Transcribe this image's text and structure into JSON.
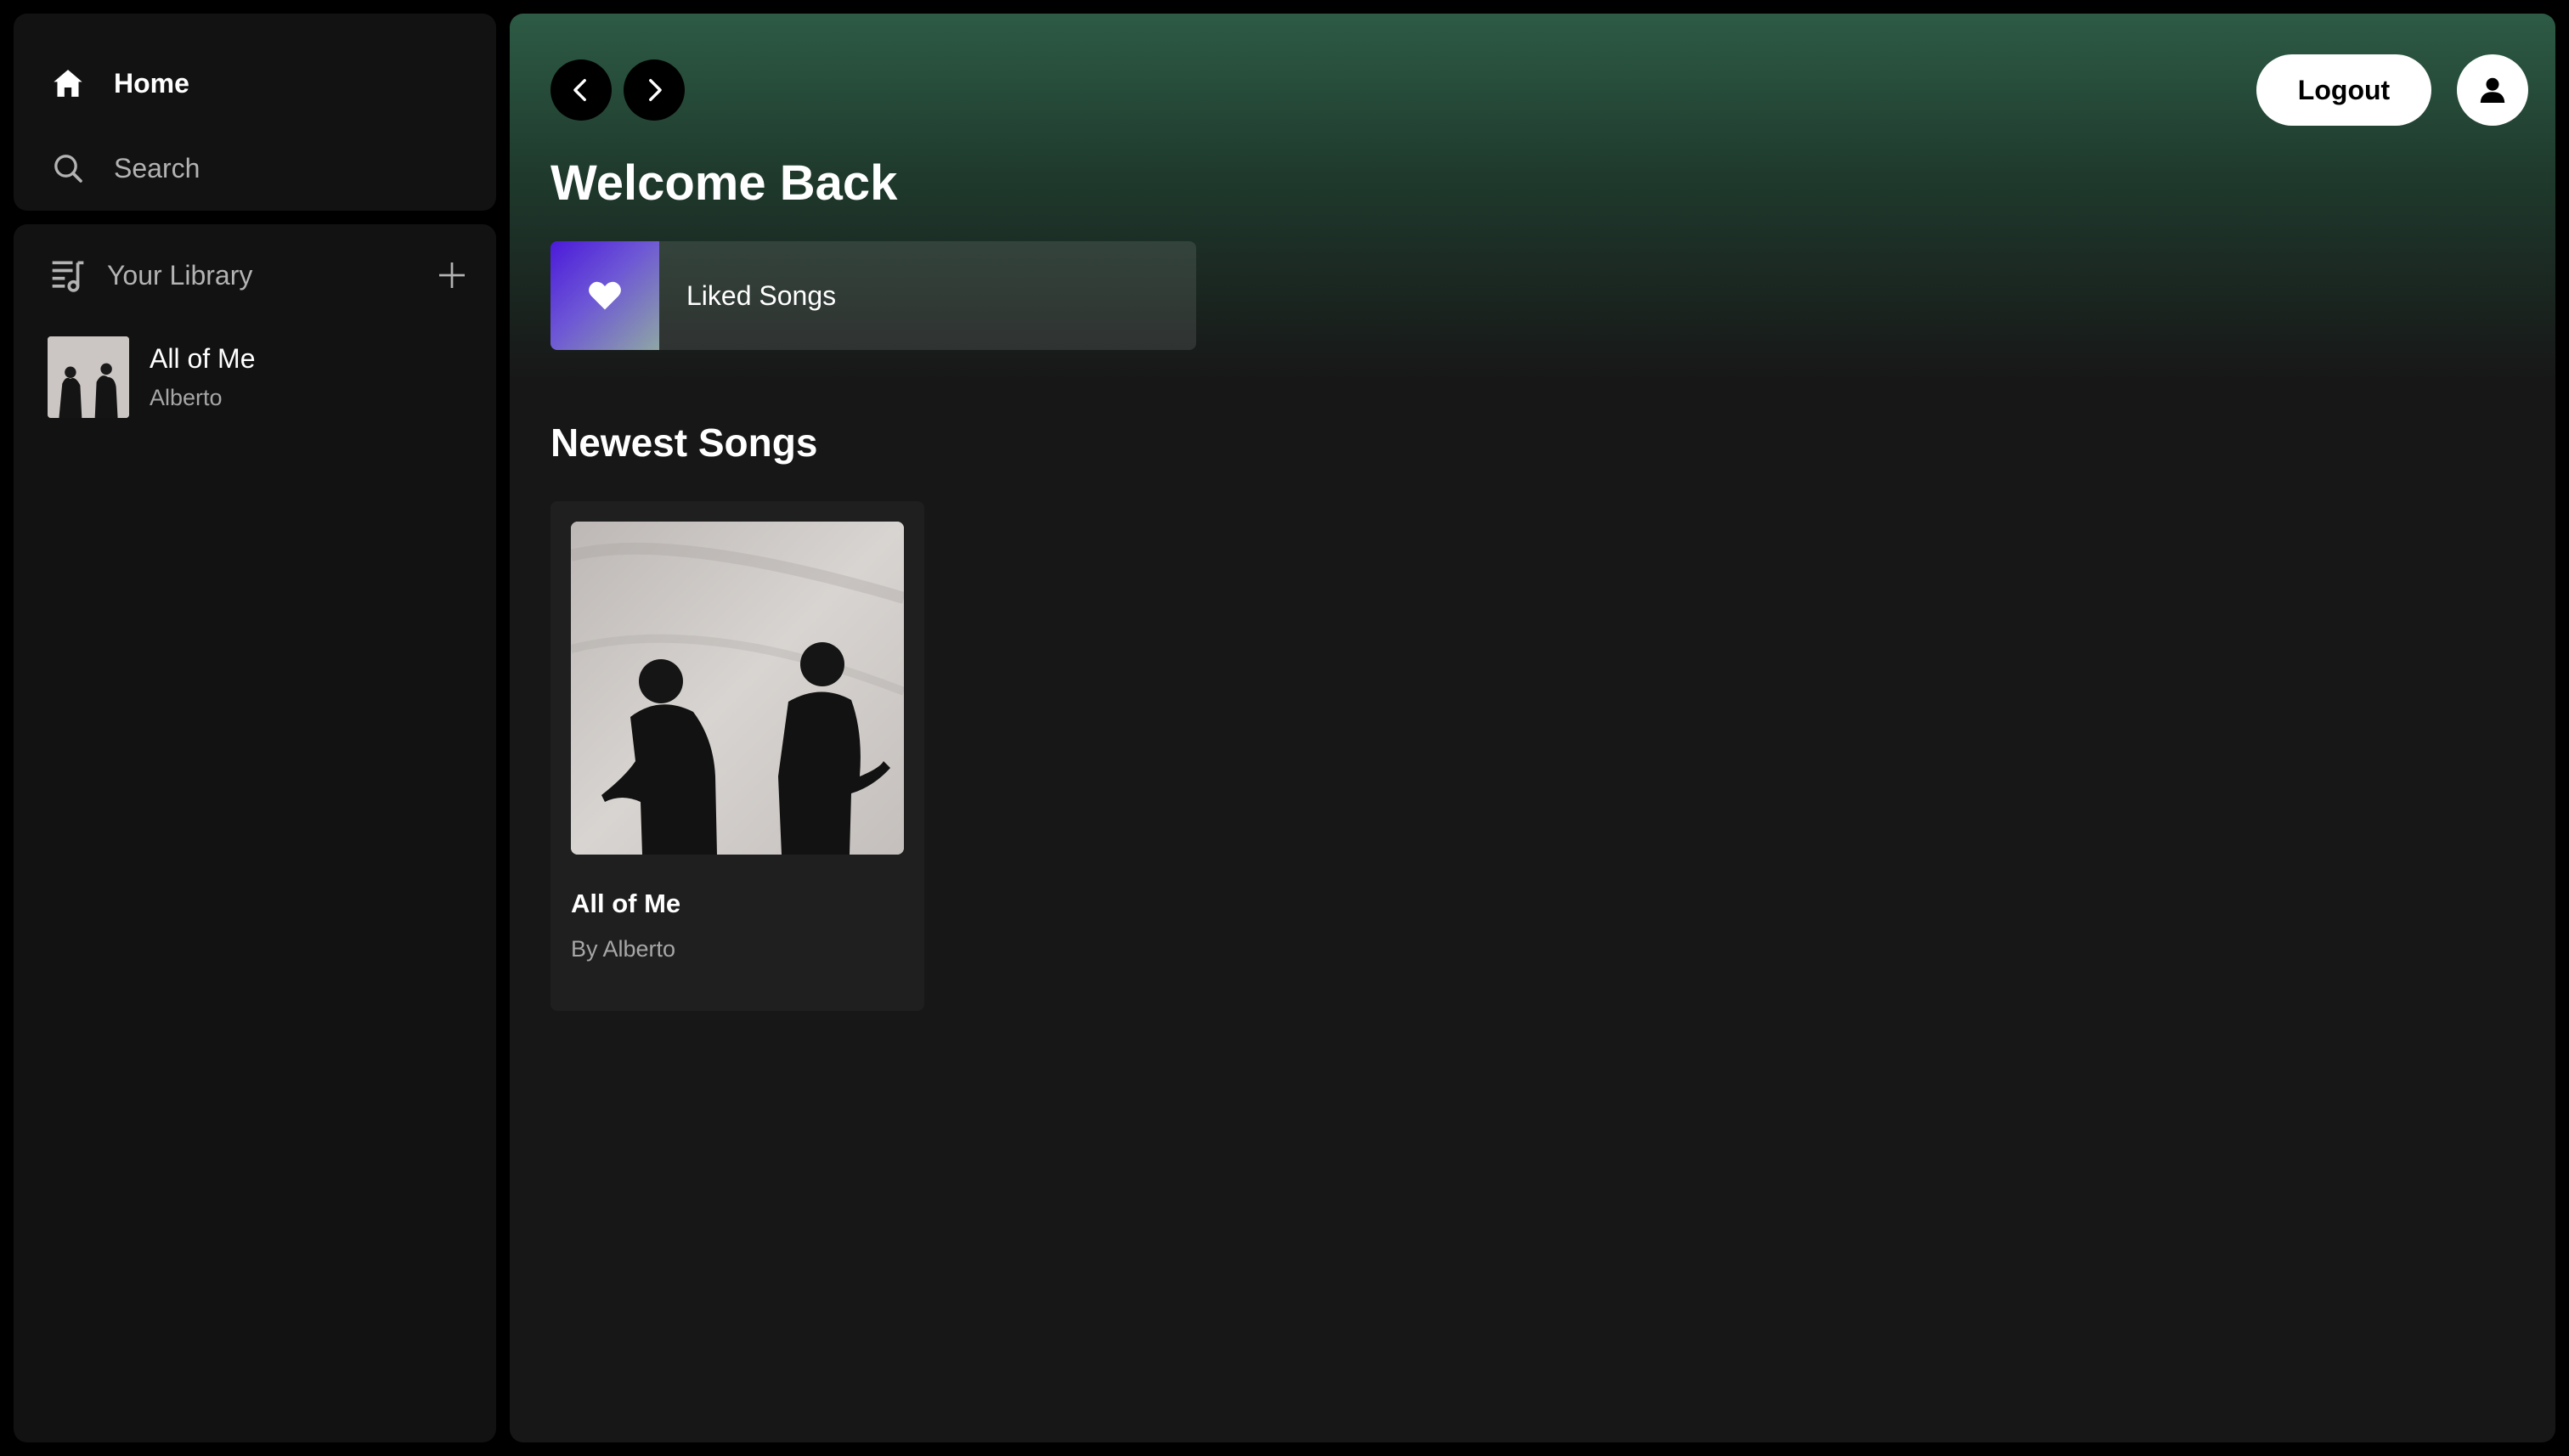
{
  "sidebar": {
    "nav": {
      "home_label": "Home",
      "search_label": "Search"
    },
    "library": {
      "title": "Your Library",
      "items": [
        {
          "title": "All of Me",
          "artist": "Alberto"
        }
      ]
    }
  },
  "main": {
    "header": {
      "logout_label": "Logout"
    },
    "welcome_title": "Welcome Back",
    "liked_songs_label": "Liked Songs",
    "newest_title": "Newest Songs",
    "songs": [
      {
        "title": "All of Me",
        "artist_line": "By Alberto"
      }
    ]
  },
  "colors": {
    "background": "#000000",
    "panel": "#121212",
    "main_bg": "#171717",
    "gradient_top": "#2d5b45",
    "card": "#1f1f1f",
    "muted_text": "#a7a7a7",
    "liked_gradient_start": "#4b1ad9"
  },
  "icons": {
    "home": "home-icon",
    "search": "search-icon",
    "library": "library-icon",
    "add": "plus-icon",
    "back": "chevron-left-icon",
    "forward": "chevron-right-icon",
    "profile": "user-icon",
    "liked": "heart-icon"
  }
}
